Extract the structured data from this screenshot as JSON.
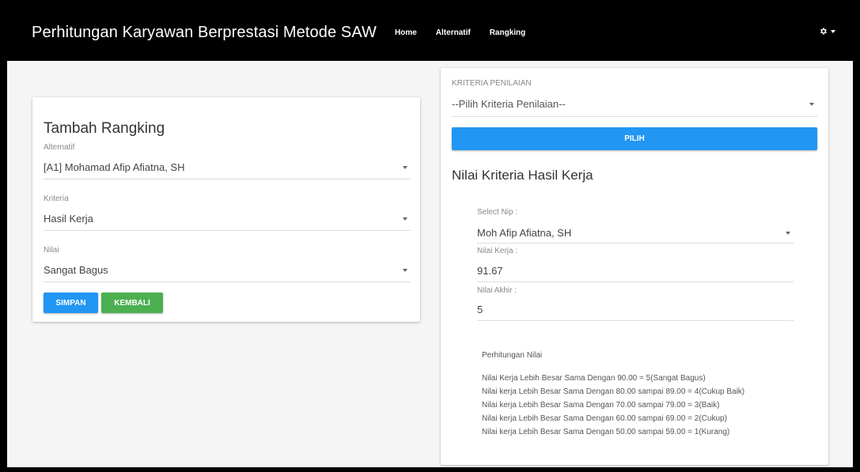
{
  "navbar": {
    "brand": "Perhitungan Karyawan Berprestasi Metode SAW",
    "links": [
      "Home",
      "Alternatif",
      "Rangking"
    ],
    "settings_icon": "gear-icon"
  },
  "form": {
    "title": "Tambah Rangking",
    "alternatif": {
      "label": "Alternatif",
      "value": "[A1] Mohamad Afip Afiatna, SH"
    },
    "kriteria": {
      "label": "Kriteria",
      "value": "Hasil Kerja"
    },
    "nilai": {
      "label": "Nilai",
      "value": "Sangat Bagus"
    },
    "save_label": "SIMPAN",
    "back_label": "KEMBALI"
  },
  "panel": {
    "criteria_label": "KRITERIA PENILAIAN",
    "criteria_value": "--Pilih Kriteria Penilaian--",
    "choose_label": "PILIH",
    "section_title": "Nilai Kriteria Hasil Kerja",
    "nip_label": "Select Nip :",
    "nip_value": "Moh Afip Afiatna, SH",
    "nilai_kerja_label": "Nilai Kerja :",
    "nilai_kerja_value": "91.67",
    "nilai_akhir_label": "Nilai Akhir :",
    "nilai_akhir_value": "5",
    "calc_title": "Perhitungan Nilai",
    "calc_lines": [
      "Nilai Kerja Lebih Besar Sama Dengan 90.00 = 5(Sangat Bagus)",
      "Nilai kerja Lebih Besar Sama Dengan 80.00 sampai 89.00 = 4(Cukup Baik)",
      "Nilai kerja Lebih Besar Sama Dengan 70.00 sampai 79.00 = 3(Baik)",
      "Nilai kerja Lebih Besar Sama Dengan 60.00 sampai 69.00 = 2(Cukup)",
      "Nilai kerja Lebih Besar Sama Dengan 50.00 sampai 59.00 = 1(Kurang)"
    ]
  },
  "colors": {
    "primary": "#2196f3",
    "success": "#4caf50",
    "navbar": "#000000"
  }
}
